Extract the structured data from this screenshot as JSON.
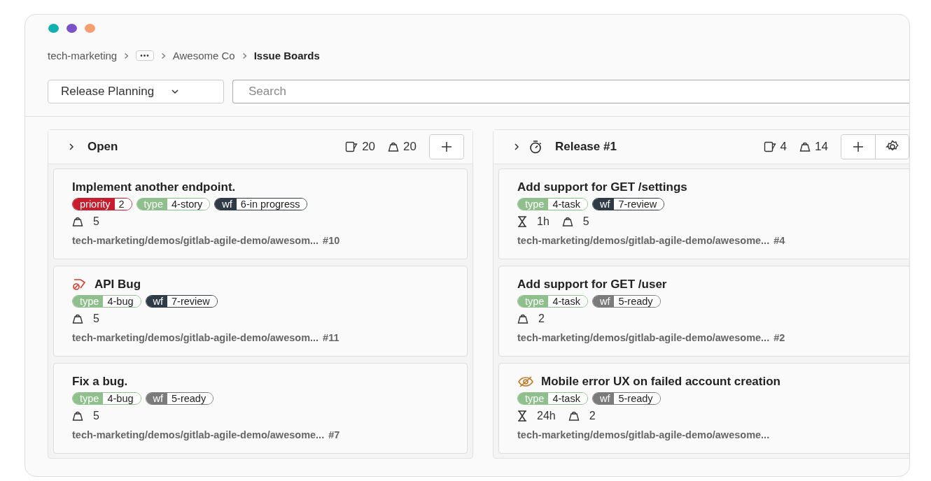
{
  "window": {
    "controls": [
      {
        "color": "#14b0b0"
      },
      {
        "color": "#7b52c7"
      },
      {
        "color": "#f79e70"
      }
    ]
  },
  "breadcrumb": [
    {
      "kind": "link",
      "label": "tech-marketing"
    },
    {
      "kind": "more",
      "label": "•••"
    },
    {
      "kind": "link",
      "label": "Awesome Co"
    },
    {
      "kind": "current",
      "label": "Issue Boards"
    }
  ],
  "toolbar": {
    "board_select": "Release Planning",
    "search": {
      "placeholder": "Search"
    }
  },
  "lists": [
    {
      "title": "Open",
      "kind": "open",
      "issue_count": "20",
      "weight": "20",
      "settings": false,
      "cards": [
        {
          "title": "Implement another endpoint.",
          "kind": "plain",
          "labels": [
            {
              "scope": "priority",
              "value": "2",
              "color": "#c91c2c"
            },
            {
              "scope": "type",
              "value": "4-story",
              "color": "#8fbf8c"
            },
            {
              "scope": "wf",
              "value": "6-in progress",
              "color": "#2f3b47"
            }
          ],
          "weight": "5",
          "path": "tech-marketing/demos/gitlab-agile-demo/awesom...",
          "number": "#10"
        },
        {
          "title": "API Bug",
          "kind": "bug",
          "labels": [
            {
              "scope": "type",
              "value": "4-bug",
              "color": "#8fbf8c"
            },
            {
              "scope": "wf",
              "value": "7-review",
              "color": "#2f3b47"
            }
          ],
          "weight": "5",
          "path": "tech-marketing/demos/gitlab-agile-demo/awesom...",
          "number": "#11"
        },
        {
          "title": "Fix a bug.",
          "kind": "plain",
          "labels": [
            {
              "scope": "type",
              "value": "4-bug",
              "color": "#8fbf8c"
            },
            {
              "scope": "wf",
              "value": "5-ready",
              "color": "#7b7b7b"
            }
          ],
          "weight": "5",
          "path": "tech-marketing/demos/gitlab-agile-demo/awesome...",
          "number": "#7"
        }
      ]
    },
    {
      "title": "Release #1",
      "kind": "milestone",
      "issue_count": "4",
      "weight": "14",
      "settings": true,
      "cards": [
        {
          "title": "Add support for GET /settings",
          "kind": "plain",
          "labels": [
            {
              "scope": "type",
              "value": "4-task",
              "color": "#8fbf8c"
            },
            {
              "scope": "wf",
              "value": "7-review",
              "color": "#2f3b47"
            }
          ],
          "time": "1h",
          "weight": "5",
          "path": "tech-marketing/demos/gitlab-agile-demo/awesome...",
          "number": "#4"
        },
        {
          "title": "Add support for GET /user",
          "kind": "plain",
          "labels": [
            {
              "scope": "type",
              "value": "4-task",
              "color": "#8fbf8c"
            },
            {
              "scope": "wf",
              "value": "5-ready",
              "color": "#7b7b7b"
            }
          ],
          "weight": "2",
          "path": "tech-marketing/demos/gitlab-agile-demo/awesome...",
          "number": "#2"
        },
        {
          "title": "Mobile error UX on failed account creation",
          "kind": "hidden",
          "labels": [
            {
              "scope": "type",
              "value": "4-task",
              "color": "#8fbf8c"
            },
            {
              "scope": "wf",
              "value": "5-ready",
              "color": "#7b7b7b"
            }
          ],
          "time": "24h",
          "weight": "2",
          "path": "tech-marketing/demos/gitlab-agile-demo/awesome..."
        }
      ]
    }
  ]
}
